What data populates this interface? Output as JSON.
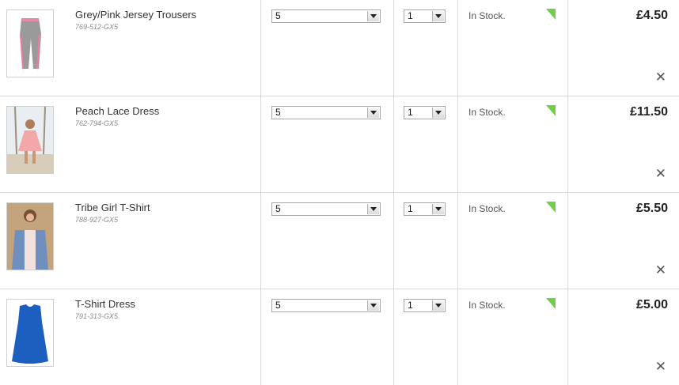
{
  "items": [
    {
      "name": "Grey/Pink Jersey Trousers",
      "code": "769-512-GX5",
      "size": "5",
      "quantity": "1",
      "stock": "In Stock.",
      "price": "£4.50",
      "remove": "✕",
      "image": "grey-pink-trousers-image"
    },
    {
      "name": "Peach Lace Dress",
      "code": "762-794-GX5",
      "size": "5",
      "quantity": "1",
      "stock": "In Stock.",
      "price": "£11.50",
      "remove": "✕",
      "image": "peach-dress-image"
    },
    {
      "name": "Tribe Girl T-Shirt",
      "code": "788-927-GX5",
      "size": "5",
      "quantity": "1",
      "stock": "In Stock.",
      "price": "£5.50",
      "remove": "✕",
      "image": "tribe-tshirt-image"
    },
    {
      "name": "T-Shirt Dress",
      "code": "791-313-GX5",
      "size": "5",
      "quantity": "1",
      "stock": "In Stock.",
      "price": "£5.00",
      "remove": "✕",
      "image": "blue-tshirt-dress-image"
    }
  ],
  "colors": {
    "stock_flag": "#6fcf4a",
    "divider": "#d9d9d9"
  }
}
